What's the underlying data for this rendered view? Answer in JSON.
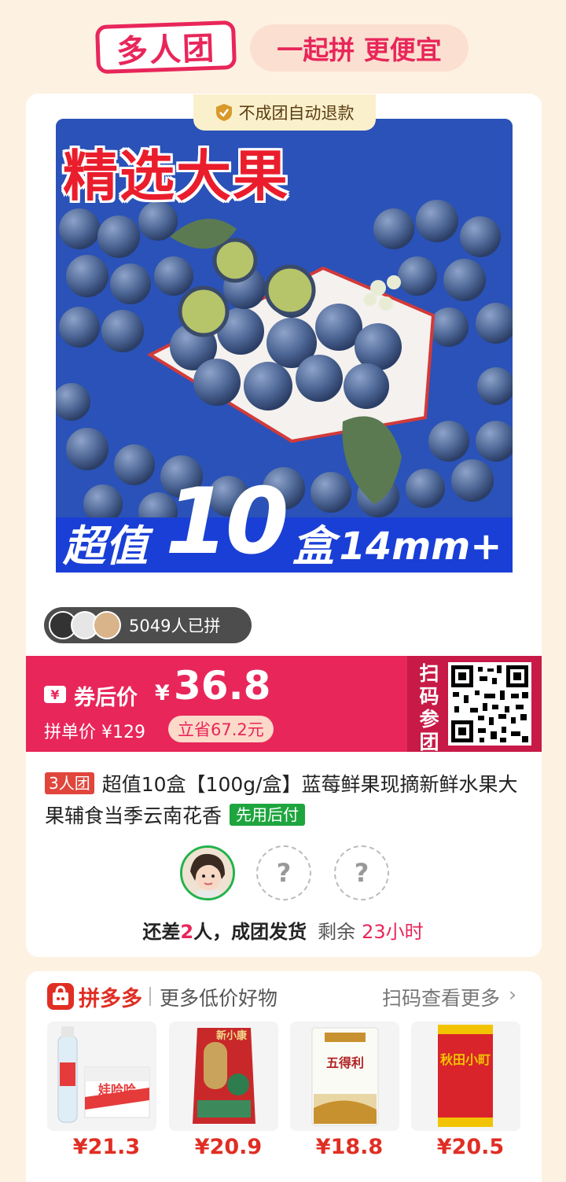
{
  "header": {
    "logo_text": "多人团",
    "slogan": "一起拼 更便宜"
  },
  "product": {
    "refund_badge": "不成团自动退款",
    "image_title": "精选大果",
    "image_banner": {
      "prefix": "超值",
      "number": "10",
      "unit": "盒",
      "size": "14mm+"
    },
    "joined_count_text": "5049人已拼"
  },
  "price": {
    "coupon_icon": "¥",
    "after_coupon_label": "券后价",
    "currency": "¥",
    "after_coupon_value": "36.8",
    "single_price_text": "拼单价 ¥129",
    "save_text": "立省67.2元",
    "scan_label": "扫码参团"
  },
  "title": {
    "group_tag": "3人团",
    "text": "超值10盒【100g/盒】蓝莓鲜果现摘新鲜水果大果辅食当季云南花香",
    "pay_later_tag": "先用后付"
  },
  "group": {
    "empty_slot_mark": "?",
    "status_prefix": "还差",
    "status_missing": "2",
    "status_suffix": "人，成团发货",
    "remaining_label": "剩余",
    "remaining_time": "23小时"
  },
  "recommend": {
    "brand": "拼多多",
    "slogan": "更多低价好物",
    "scan_more": "扫码查看更多",
    "chevron_icon": "chevron-right-icon",
    "items": [
      {
        "price": "¥21.3",
        "label": "娃哈哈"
      },
      {
        "price": "¥20.9",
        "label": "新小康"
      },
      {
        "price": "¥18.8",
        "label": "五得利"
      },
      {
        "price": "¥20.5",
        "label": "秋田小町"
      }
    ]
  },
  "colors": {
    "accent": "#e8265a",
    "background": "#fdf1e2",
    "pay_later_green": "#1ea53e",
    "pdd_red": "#e02e24"
  }
}
